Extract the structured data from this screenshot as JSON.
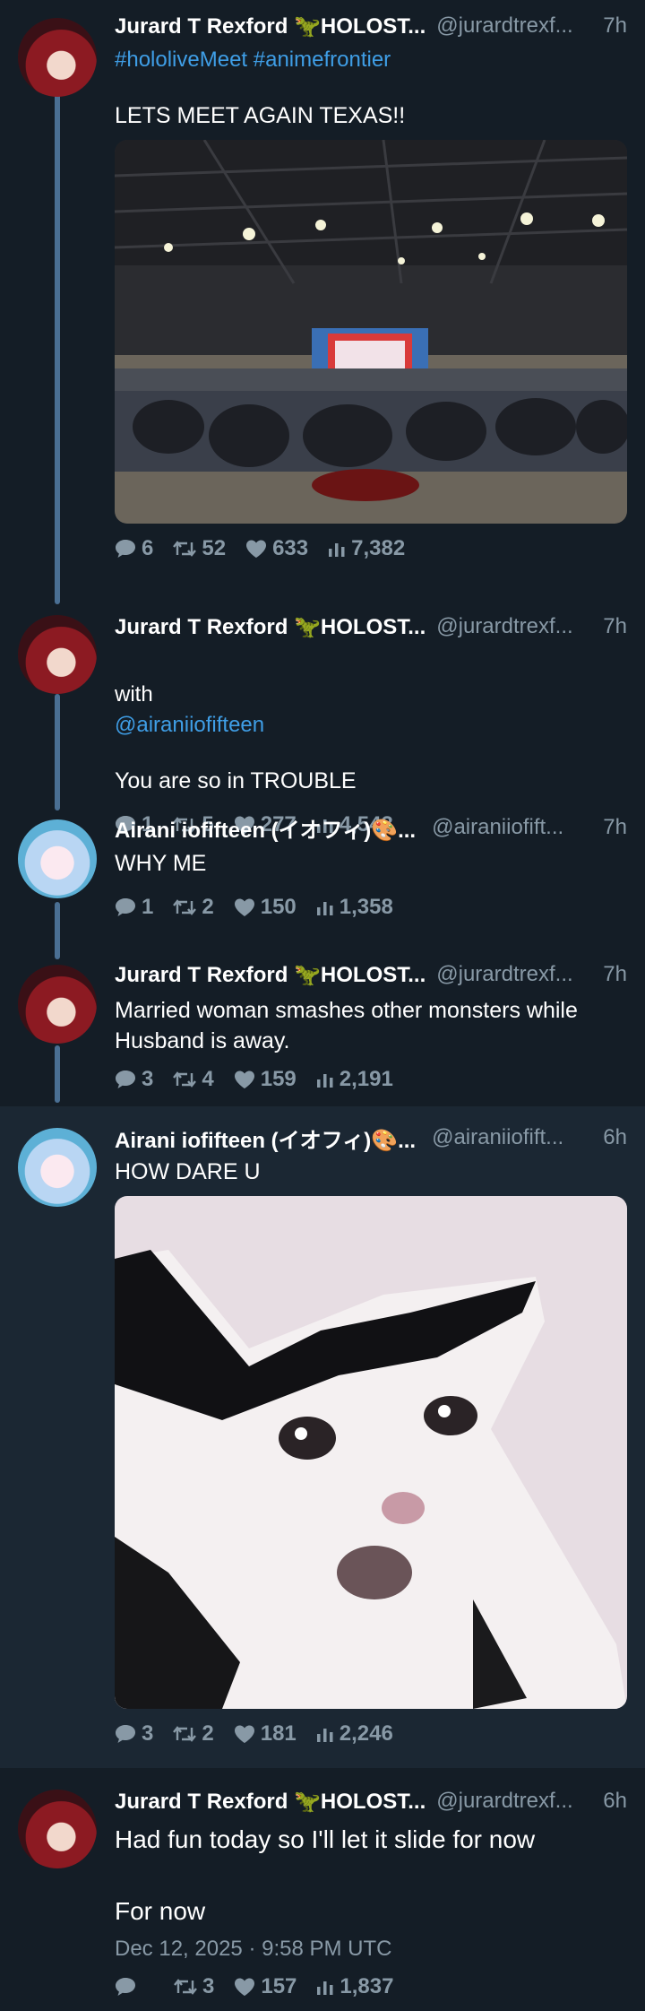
{
  "tweets": [
    {
      "name": "Jurard T Rexford 🦖HOLOST...",
      "handle": "@jurardtrexf...",
      "time": "7h",
      "mention_prefix": "",
      "tags": "#hololiveMeet #animefrontier",
      "text": "LETS MEET AGAIN TEXAS!!",
      "stats": {
        "replies": "6",
        "retweets": "52",
        "likes": "633",
        "views": "7,382"
      }
    },
    {
      "name": "Jurard T Rexford 🦖HOLOST...",
      "handle": "@jurardtrexf...",
      "time": "7h",
      "mention_prefix": "with",
      "mention": "@airaniiofifteen",
      "text": "You are so in TROUBLE",
      "stats": {
        "replies": "1",
        "retweets": "5",
        "likes": "277",
        "views": "4,543"
      }
    },
    {
      "name": "Airani iofifteen (イオフィ)🎨...",
      "handle": "@airaniiofift...",
      "time": "7h",
      "text": "WHY ME",
      "stats": {
        "replies": "1",
        "retweets": "2",
        "likes": "150",
        "views": "1,358"
      }
    },
    {
      "name": "Jurard T Rexford 🦖HOLOST...",
      "handle": "@jurardtrexf...",
      "time": "7h",
      "text": "Married woman smashes other monsters while Husband is away.",
      "stats": {
        "replies": "3",
        "retweets": "4",
        "likes": "159",
        "views": "2,191"
      }
    },
    {
      "name": "Airani iofifteen (イオフィ)🎨...",
      "handle": "@airaniiofift...",
      "time": "6h",
      "text": "HOW DARE U",
      "stats": {
        "replies": "3",
        "retweets": "2",
        "likes": "181",
        "views": "2,246"
      }
    },
    {
      "name": "Jurard T Rexford 🦖HOLOST...",
      "handle": "@jurardtrexf...",
      "time": "6h",
      "text": "Had fun today so I'll let it slide for now\n\nFor now",
      "date": "Dec 12, 2025 · 9:58 PM UTC",
      "stats": {
        "replies": "",
        "retweets": "3",
        "likes": "157",
        "views": "1,837"
      }
    }
  ],
  "colors": {
    "background": "#141d26",
    "highlight": "#1b2733",
    "link": "#3f9ee6",
    "muted": "#8899a6",
    "thread_line": "#4a6f93"
  }
}
